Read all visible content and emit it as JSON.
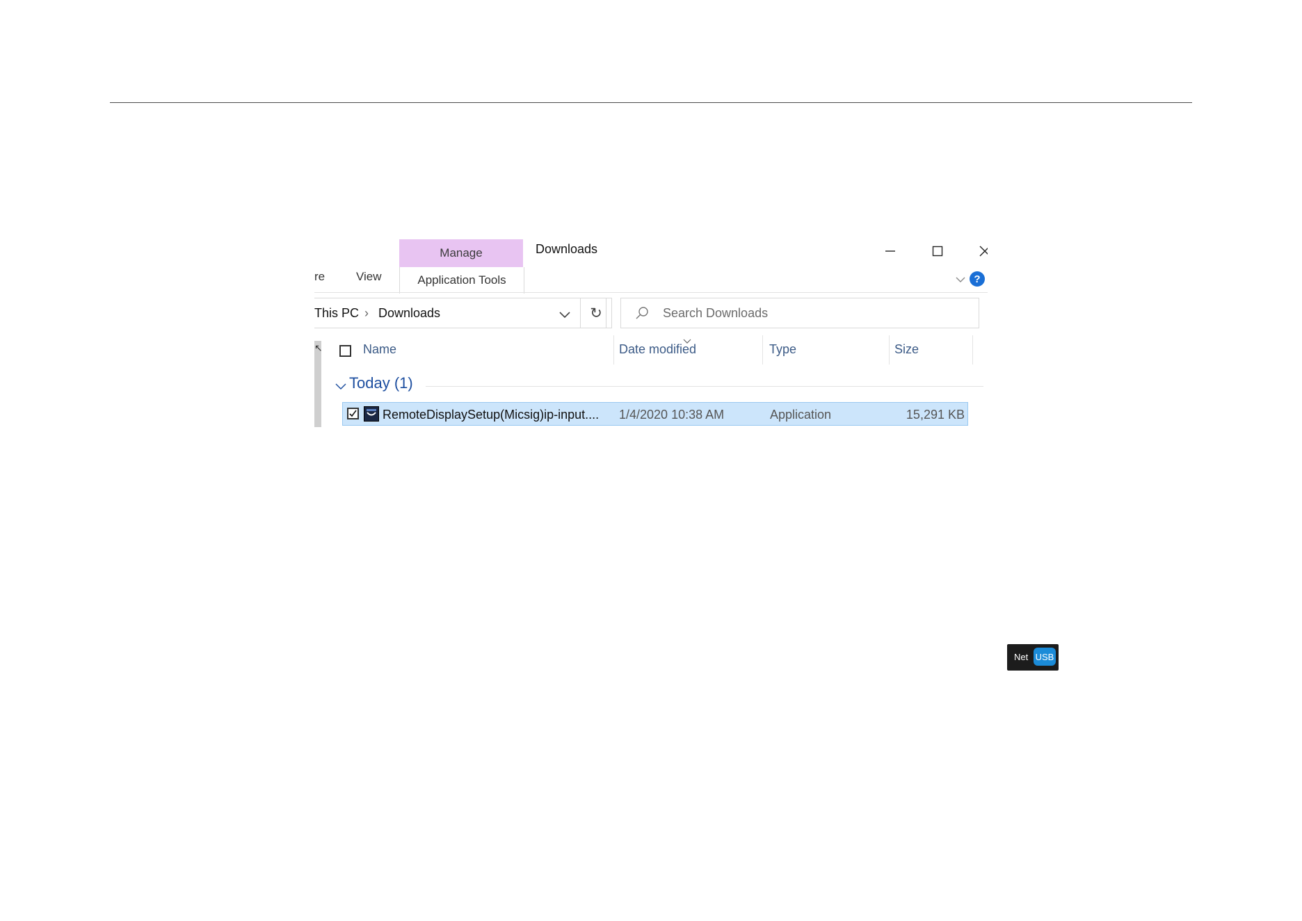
{
  "window": {
    "title": "Downloads",
    "contextual_tab": "Manage",
    "contextual_group": "Application Tools"
  },
  "ribbon": {
    "tabs": [
      "re",
      "View"
    ]
  },
  "address": {
    "this_pc": "This PC",
    "separator": "›",
    "folder": "Downloads"
  },
  "search": {
    "placeholder": "Search Downloads"
  },
  "columns": {
    "name": "Name",
    "date": "Date modified",
    "type": "Type",
    "size": "Size"
  },
  "group": {
    "title": "Today (1)"
  },
  "file": {
    "name": "RemoteDisplaySetup(Micsig)ip-input....",
    "date": "1/4/2020 10:38 AM",
    "type": "Application",
    "size": "15,291 KB",
    "selected": true
  },
  "badge": {
    "net": "Net",
    "usb": "USB"
  },
  "colors": {
    "accent": "#1a6fd6",
    "selection": "#cce5fb",
    "manage_tab": "#e8c4f2",
    "usb": "#1b8bd8"
  }
}
